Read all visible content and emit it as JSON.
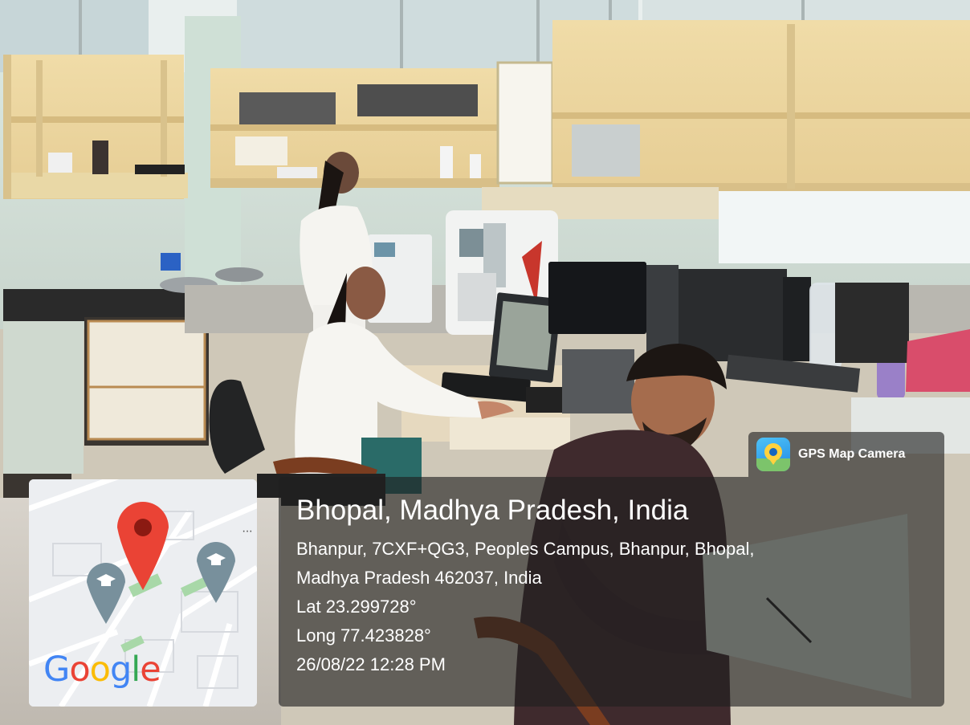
{
  "photo": {
    "description_icon": "lab-scene"
  },
  "gps_badge": {
    "label": "GPS Map Camera",
    "icon": "map-pin-icon"
  },
  "location": {
    "title": "Bhopal, Madhya Pradesh, India",
    "address_line1": "Bhanpur, 7CXF+QG3, Peoples Campus, Bhanpur, Bhopal,",
    "address_line2": "Madhya Pradesh 462037, India",
    "lat": "Lat 23.299728°",
    "long": "Long 77.423828°",
    "datetime": "26/08/22 12:28 PM"
  },
  "map": {
    "more_glyph": "···",
    "logo_letters": [
      {
        "ch": "G",
        "color": "#4285F4"
      },
      {
        "ch": "o",
        "color": "#EA4335"
      },
      {
        "ch": "o",
        "color": "#FBBC05"
      },
      {
        "ch": "g",
        "color": "#4285F4"
      },
      {
        "ch": "l",
        "color": "#34A853"
      },
      {
        "ch": "e",
        "color": "#EA4335"
      }
    ],
    "pin_color": "#EA4335",
    "school_marker_color": "#78909C"
  }
}
